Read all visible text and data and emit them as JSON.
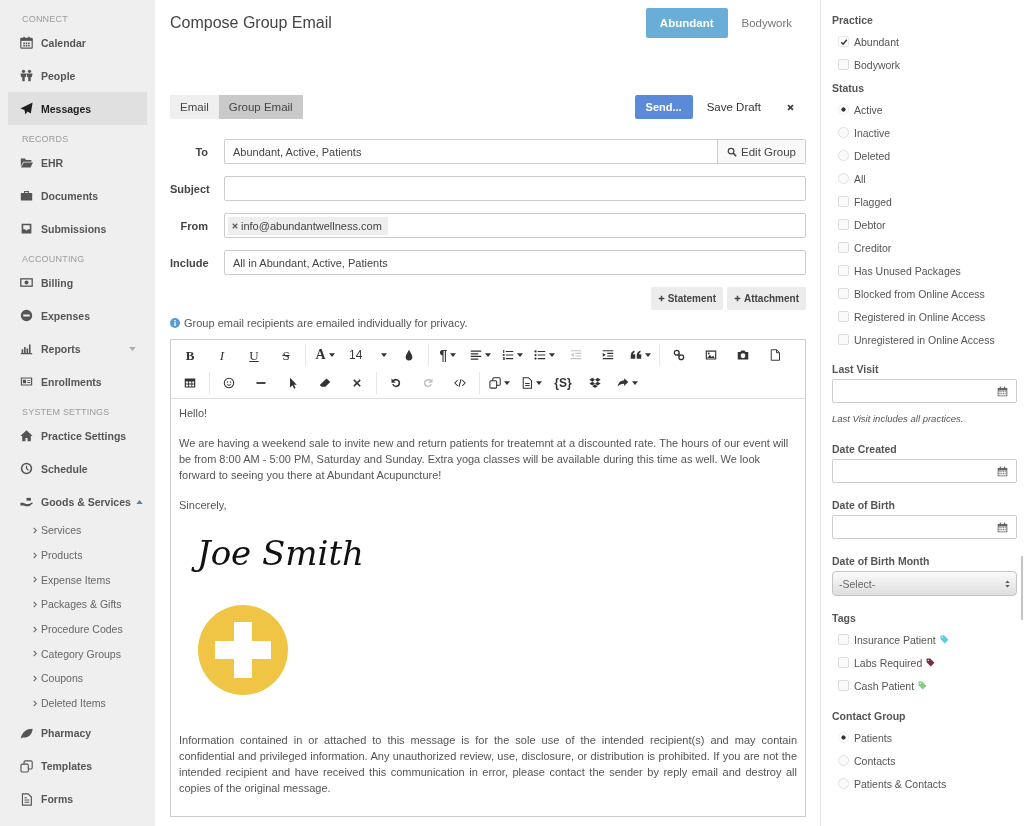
{
  "sidebar": {
    "sections": [
      {
        "header": "CONNECT",
        "items": [
          {
            "label": "Calendar",
            "kind": "calendar",
            "selected": false
          },
          {
            "label": "People",
            "kind": "people",
            "selected": false
          },
          {
            "label": "Messages",
            "kind": "send",
            "selected": true
          }
        ]
      },
      {
        "header": "RECORDS",
        "items": [
          {
            "label": "EHR",
            "kind": "folder",
            "selected": false
          },
          {
            "label": "Documents",
            "kind": "briefcase",
            "selected": false
          },
          {
            "label": "Submissions",
            "kind": "inbox",
            "selected": false
          }
        ]
      },
      {
        "header": "ACCOUNTING",
        "items": [
          {
            "label": "Billing",
            "kind": "money",
            "selected": false
          },
          {
            "label": "Expenses",
            "kind": "minus",
            "selected": false
          },
          {
            "label": "Reports",
            "kind": "chart",
            "selected": false,
            "expanded": false
          },
          {
            "label": "Enrollments",
            "kind": "card",
            "selected": false
          }
        ]
      },
      {
        "header": "SYSTEM SETTINGS",
        "items": [
          {
            "label": "Practice Settings",
            "kind": "home",
            "selected": false
          },
          {
            "label": "Schedule",
            "kind": "clock",
            "selected": false
          },
          {
            "label": "Goods & Services",
            "kind": "hand",
            "selected": false,
            "expanded": true,
            "children": [
              {
                "label": "Services",
                "selected": false
              },
              {
                "label": "Products",
                "selected": false
              },
              {
                "label": "Expense Items",
                "selected": false
              },
              {
                "label": "Packages & Gifts",
                "selected": false
              },
              {
                "label": "Procedure Codes",
                "selected": false
              },
              {
                "label": "Category Groups",
                "selected": false
              },
              {
                "label": "Coupons",
                "selected": false
              },
              {
                "label": "Deleted Items",
                "selected": false
              }
            ]
          },
          {
            "label": "Pharmacy",
            "kind": "leaf",
            "selected": false
          },
          {
            "label": "Templates",
            "kind": "copy",
            "selected": false
          },
          {
            "label": "Forms",
            "kind": "file",
            "selected": false
          }
        ]
      }
    ]
  },
  "compose": {
    "title": "Compose Group Email",
    "practices": [
      {
        "label": "Abundant",
        "selected": true
      },
      {
        "label": "Bodywork",
        "selected": false
      }
    ],
    "modes": [
      {
        "label": "Email",
        "selected": false
      },
      {
        "label": "Group Email",
        "selected": true
      }
    ],
    "actions": [
      {
        "kind": "send",
        "label": "Send..."
      },
      {
        "kind": "draft",
        "label": "Save Draft"
      },
      {
        "kind": "close"
      }
    ],
    "fields": [
      {
        "label": "To",
        "kind": "group",
        "value": "Abundant, Active, Patients",
        "button": "Edit Group"
      },
      {
        "label": "Subject",
        "kind": "text"
      },
      {
        "label": "From",
        "kind": "tags",
        "tags": [
          "info@abundantwellness.com"
        ]
      },
      {
        "label": "Include",
        "kind": "text",
        "value": "All in Abundant, Active, Patients"
      }
    ],
    "attach_buttons": [
      "Statement",
      "Attachment"
    ],
    "note": "Group email recipients are emailed individually for privacy.",
    "toolbar": [
      [
        [
          {
            "kind": "bold",
            "label": "B",
            "caret": false,
            "disabled": false
          },
          {
            "kind": "italic",
            "label": "I",
            "caret": false,
            "disabled": false
          },
          {
            "kind": "underline",
            "label": "U",
            "caret": false,
            "disabled": false
          },
          {
            "kind": "strike",
            "label": "S",
            "caret": false,
            "disabled": false
          }
        ],
        [
          {
            "kind": "font-color",
            "label": "A",
            "caret": true,
            "disabled": false
          },
          {
            "kind": "font-size",
            "label": "14",
            "caret": true,
            "disabled": false
          },
          {
            "kind": "droplet",
            "caret": false,
            "disabled": false
          }
        ],
        [
          {
            "kind": "paragraph",
            "label": "¶",
            "caret": true,
            "disabled": false
          },
          {
            "kind": "align",
            "caret": true,
            "disabled": false
          },
          {
            "kind": "ordered-list",
            "caret": true,
            "disabled": false
          },
          {
            "kind": "bullet-list",
            "caret": true,
            "disabled": false
          },
          {
            "kind": "outdent",
            "caret": false,
            "disabled": true
          },
          {
            "kind": "indent",
            "caret": false,
            "disabled": false
          },
          {
            "kind": "quote",
            "caret": true,
            "disabled": false
          }
        ],
        [
          {
            "kind": "link",
            "caret": false,
            "disabled": false
          },
          {
            "kind": "image",
            "caret": false,
            "disabled": false
          },
          {
            "kind": "camera",
            "caret": false,
            "disabled": false
          },
          {
            "kind": "file",
            "caret": false,
            "disabled": false
          }
        ]
      ],
      [
        [
          {
            "kind": "table",
            "caret": false,
            "disabled": false
          }
        ],
        [
          {
            "kind": "emoji",
            "caret": false,
            "disabled": false
          },
          {
            "kind": "rule",
            "caret": false,
            "disabled": false
          },
          {
            "kind": "pointer",
            "caret": false,
            "disabled": false
          },
          {
            "kind": "eraser",
            "caret": false,
            "disabled": false
          },
          {
            "kind": "clear",
            "caret": false,
            "disabled": false
          }
        ],
        [
          {
            "kind": "undo",
            "caret": false,
            "disabled": false
          },
          {
            "kind": "redo",
            "caret": false,
            "disabled": true
          },
          {
            "kind": "code",
            "caret": false,
            "disabled": false
          }
        ],
        [
          {
            "kind": "paste",
            "caret": true,
            "disabled": false
          },
          {
            "kind": "document",
            "caret": true,
            "disabled": false
          },
          {
            "kind": "variable",
            "label": "{S}",
            "caret": false,
            "disabled": false
          },
          {
            "kind": "dropbox",
            "caret": false,
            "disabled": false
          },
          {
            "kind": "share",
            "caret": true,
            "disabled": false
          }
        ]
      ]
    ],
    "body": [
      {
        "kind": "text",
        "text": "Hello!"
      },
      {
        "kind": "text",
        "text": "We are having a weekend sale to invite new and return patients for treatemnt at a discounted rate. The hours of our event will be from 8:00 AM - 5:00 PM, Saturday and Sunday. Extra yoga classes will be available during this time as well. We look forward to seeing you there at Abundant Acupuncture!"
      },
      {
        "kind": "text",
        "text": "Sincerely,"
      },
      {
        "kind": "signature",
        "text": "Joe Smith"
      },
      {
        "kind": "logo"
      },
      {
        "kind": "notice",
        "text": "Information contained in or attached to this message is for the sole use of the intended recipient(s) and may contain confidential and privileged information. Any unauthorized review, use, disclosure, or distribution is prohibited. If you are not the intended recipient and have received this communication in error, please contact the sender by reply email and destroy all copies of the original message."
      }
    ]
  },
  "filters": [
    {
      "kind": "options",
      "title": "Practice",
      "options": [
        {
          "kind": "checkbox",
          "label": "Abundant",
          "checked": true
        },
        {
          "kind": "checkbox",
          "label": "Bodywork",
          "checked": false
        }
      ]
    },
    {
      "kind": "options",
      "title": "Status",
      "options": [
        {
          "kind": "radio",
          "label": "Active",
          "selected": true
        },
        {
          "kind": "radio",
          "label": "Inactive",
          "selected": false
        },
        {
          "kind": "radio",
          "label": "Deleted",
          "selected": false
        },
        {
          "kind": "radio",
          "label": "All",
          "selected": false
        },
        {
          "kind": "checkbox",
          "label": "Flagged",
          "checked": false
        },
        {
          "kind": "checkbox",
          "label": "Debtor",
          "checked": false
        },
        {
          "kind": "checkbox",
          "label": "Creditor",
          "checked": false
        },
        {
          "kind": "checkbox",
          "label": "Has Unused Packages",
          "checked": false
        },
        {
          "kind": "checkbox",
          "label": "Blocked from Online Access",
          "checked": false
        },
        {
          "kind": "checkbox",
          "label": "Registered in Online Access",
          "checked": false
        },
        {
          "kind": "checkbox",
          "label": "Unregistered in Online Access",
          "checked": false
        }
      ]
    },
    {
      "kind": "date",
      "title": "Last Visit",
      "note": "Last Visit includes all practices."
    },
    {
      "kind": "date",
      "title": "Date Created"
    },
    {
      "kind": "date",
      "title": "Date of Birth"
    },
    {
      "kind": "select",
      "title": "Date of Birth Month",
      "value": "-Select-"
    },
    {
      "kind": "options",
      "title": "Tags",
      "options": [
        {
          "kind": "checkbox",
          "label": "Insurance Patient",
          "checked": false,
          "color": "#5bc8e6"
        },
        {
          "kind": "checkbox",
          "label": "Labs Required",
          "checked": false,
          "color": "#7a2f3f"
        },
        {
          "kind": "checkbox",
          "label": "Cash Patient",
          "checked": false,
          "color": "#86c98a"
        }
      ]
    },
    {
      "kind": "options",
      "title": "Contact Group",
      "options": [
        {
          "kind": "radio",
          "label": "Patients",
          "selected": true
        },
        {
          "kind": "radio",
          "label": "Contacts",
          "selected": false
        },
        {
          "kind": "radio",
          "label": "Patients & Contacts",
          "selected": false
        }
      ]
    }
  ]
}
